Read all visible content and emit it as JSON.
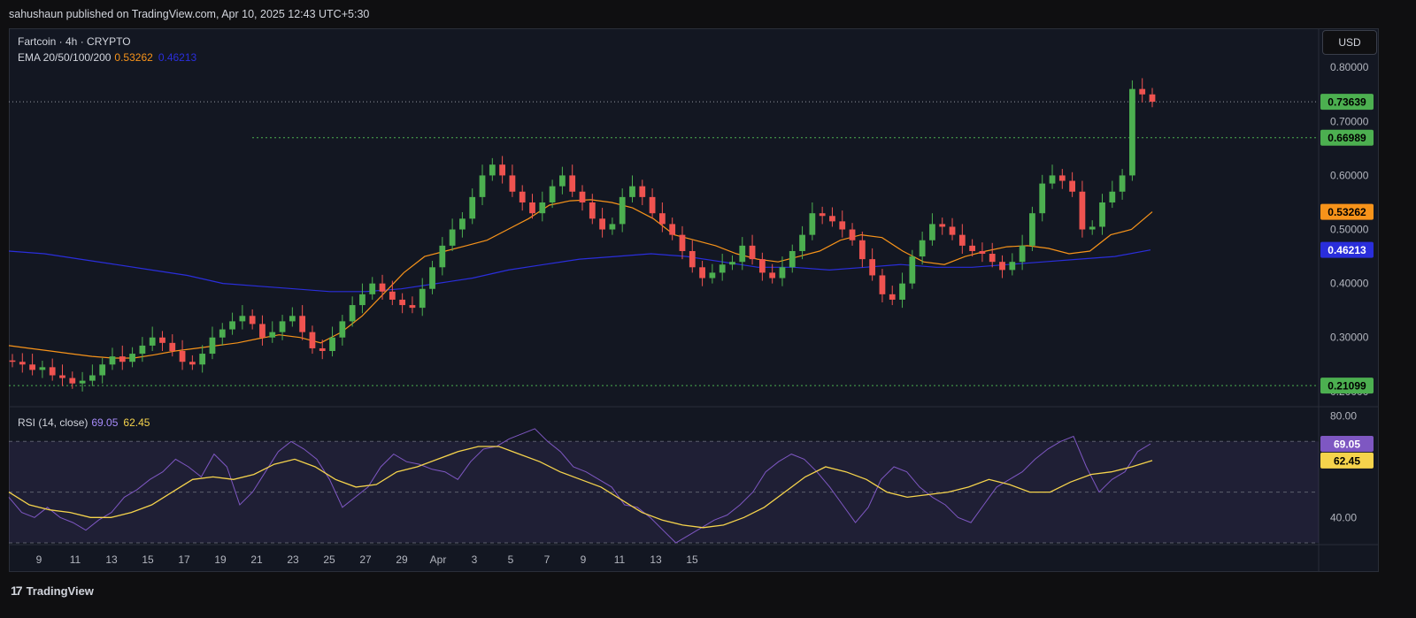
{
  "header": {
    "publisher_line": "sahushaun published on TradingView.com, Apr 10, 2025 12:43 UTC+5:30"
  },
  "legend": {
    "symbol_line": "Fartcoin · 4h · CRYPTO",
    "ema_label": "EMA 20/50/100/200",
    "ema20_value": "0.53262",
    "ema200_value": "0.46213",
    "rsi_label": "RSI (14, close)",
    "rsi_value": "69.05",
    "rsi_ma_value": "62.45"
  },
  "currency_button": "USD",
  "footer": {
    "brand": "TradingView",
    "logo_mark": "17"
  },
  "colors": {
    "background": "#131722",
    "up": "#26a69a",
    "up_candle": "#4caf50",
    "down_candle": "#ef5350",
    "ema20": "#f7931a",
    "ema200": "#2a2edb",
    "rsi": "#7e57c2",
    "rsi_ma": "#f5d34c",
    "level_green": "#4caf50"
  },
  "chart_data": [
    {
      "type": "candlestick",
      "title": "Fartcoin · 4h · CRYPTO",
      "ylabel": "USD",
      "ylim": [
        0.185,
        0.82
      ],
      "y_tick_labels": [
        "0.80000",
        "0.70000",
        "0.60000",
        "0.50000",
        "0.40000",
        "0.30000",
        "0.20000"
      ],
      "y_ticks": [
        0.8,
        0.7,
        0.6,
        0.5,
        0.4,
        0.3,
        0.2
      ],
      "x_tick_labels": [
        "9",
        "11",
        "13",
        "15",
        "17",
        "19",
        "21",
        "23",
        "25",
        "27",
        "29",
        "Apr",
        "3",
        "5",
        "7",
        "9",
        "11",
        "13",
        "15"
      ],
      "price_labels": [
        {
          "value": 0.73639,
          "text": "0.73639",
          "kind": "last_price"
        },
        {
          "value": 0.66989,
          "text": "0.66989",
          "kind": "level"
        },
        {
          "value": 0.53262,
          "text": "0.53262",
          "kind": "ema20"
        },
        {
          "value": 0.46213,
          "text": "0.46213",
          "kind": "ema200"
        },
        {
          "value": 0.21099,
          "text": "0.21099",
          "kind": "level"
        }
      ],
      "candle_interval": "4h",
      "candle_close_path": [
        0.255,
        0.25,
        0.24,
        0.245,
        0.23,
        0.225,
        0.215,
        0.22,
        0.23,
        0.25,
        0.265,
        0.255,
        0.27,
        0.285,
        0.3,
        0.29,
        0.275,
        0.255,
        0.25,
        0.27,
        0.3,
        0.315,
        0.33,
        0.34,
        0.325,
        0.3,
        0.31,
        0.33,
        0.34,
        0.31,
        0.28,
        0.275,
        0.3,
        0.33,
        0.36,
        0.38,
        0.4,
        0.385,
        0.37,
        0.36,
        0.355,
        0.39,
        0.43,
        0.47,
        0.5,
        0.52,
        0.56,
        0.6,
        0.62,
        0.6,
        0.57,
        0.55,
        0.53,
        0.55,
        0.58,
        0.6,
        0.57,
        0.55,
        0.52,
        0.5,
        0.51,
        0.56,
        0.58,
        0.56,
        0.53,
        0.51,
        0.49,
        0.46,
        0.43,
        0.41,
        0.42,
        0.435,
        0.44,
        0.47,
        0.445,
        0.42,
        0.41,
        0.43,
        0.46,
        0.49,
        0.53,
        0.525,
        0.515,
        0.5,
        0.48,
        0.445,
        0.415,
        0.38,
        0.37,
        0.4,
        0.45,
        0.48,
        0.51,
        0.505,
        0.49,
        0.47,
        0.46,
        0.455,
        0.44,
        0.425,
        0.44,
        0.47,
        0.53,
        0.585,
        0.6,
        0.59,
        0.57,
        0.5,
        0.505,
        0.55,
        0.57,
        0.6,
        0.76,
        0.75,
        0.73639
      ],
      "series": [
        {
          "name": "EMA 20",
          "values": [
            0.285,
            0.28,
            0.275,
            0.27,
            0.265,
            0.262,
            0.262,
            0.268,
            0.275,
            0.28,
            0.285,
            0.29,
            0.298,
            0.305,
            0.3,
            0.29,
            0.31,
            0.34,
            0.38,
            0.42,
            0.45,
            0.46,
            0.47,
            0.48,
            0.5,
            0.52,
            0.545,
            0.553,
            0.555,
            0.55,
            0.54,
            0.52,
            0.49,
            0.48,
            0.47,
            0.455,
            0.445,
            0.44,
            0.45,
            0.46,
            0.48,
            0.49,
            0.485,
            0.46,
            0.44,
            0.435,
            0.45,
            0.46,
            0.468,
            0.47,
            0.465,
            0.455,
            0.46,
            0.49,
            0.5,
            0.53262
          ]
        },
        {
          "name": "EMA 200",
          "values": [
            0.46,
            0.455,
            0.445,
            0.435,
            0.425,
            0.415,
            0.4,
            0.395,
            0.39,
            0.385,
            0.385,
            0.39,
            0.4,
            0.41,
            0.425,
            0.435,
            0.445,
            0.45,
            0.455,
            0.45,
            0.44,
            0.43,
            0.43,
            0.425,
            0.43,
            0.435,
            0.43,
            0.43,
            0.435,
            0.44,
            0.445,
            0.45,
            0.46213
          ]
        }
      ]
    },
    {
      "type": "line",
      "title": "RSI (14, close)",
      "ylim": [
        30,
        83
      ],
      "y_tick_labels": [
        "80.00",
        "40.00"
      ],
      "y_ticks": [
        80,
        40
      ],
      "bands": {
        "upper": 70,
        "middle": 50,
        "lower": 30
      },
      "value_labels": [
        {
          "value": 69.05,
          "text": "69.05"
        },
        {
          "value": 62.45,
          "text": "62.45"
        }
      ],
      "series": [
        {
          "name": "RSI",
          "values": [
            48,
            42,
            40,
            44,
            40,
            38,
            35,
            39,
            42,
            48,
            51,
            55,
            58,
            63,
            60,
            56,
            65,
            60,
            45,
            50,
            58,
            66,
            70,
            67,
            63,
            55,
            44,
            48,
            52,
            60,
            65,
            62,
            61,
            59,
            58,
            55,
            62,
            67,
            68,
            71,
            73,
            75,
            70,
            66,
            60,
            58,
            55,
            52,
            45,
            44,
            40,
            35,
            30,
            33,
            36,
            39,
            41,
            45,
            50,
            58,
            62,
            65,
            63,
            58,
            52,
            45,
            38,
            44,
            55,
            60,
            58,
            52,
            48,
            45,
            40,
            38,
            45,
            52,
            55,
            58,
            63,
            67,
            70,
            72,
            60,
            50,
            55,
            58,
            66,
            69.05
          ]
        },
        {
          "name": "RSI MA",
          "values": [
            50,
            45,
            43,
            42,
            40,
            40,
            42,
            45,
            50,
            55,
            56,
            55,
            57,
            61,
            63,
            60,
            55,
            52,
            53,
            58,
            60,
            63,
            66,
            68,
            68,
            65,
            62,
            58,
            55,
            52,
            47,
            42,
            39,
            37,
            36,
            37,
            40,
            44,
            50,
            56,
            60,
            58,
            55,
            50,
            48,
            49,
            50,
            52,
            55,
            53,
            50,
            50,
            54,
            57,
            58,
            60,
            62.45
          ]
        }
      ]
    }
  ]
}
